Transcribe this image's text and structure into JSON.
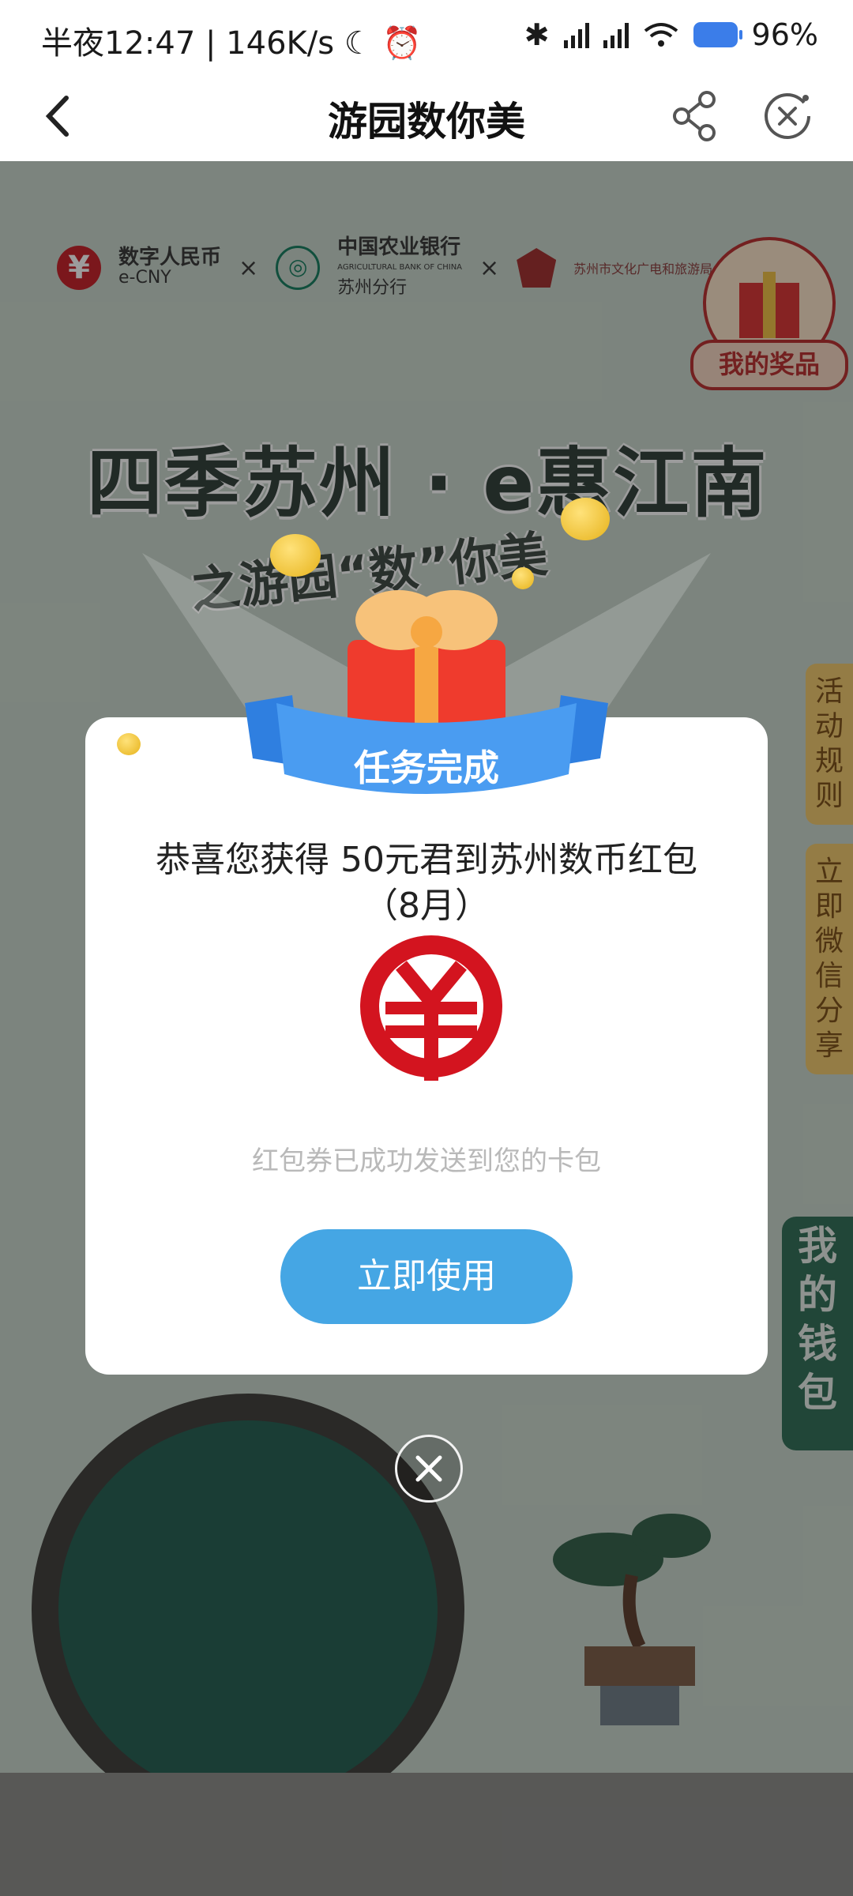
{
  "status_bar": {
    "time_text": "半夜12:47 | 146K/s",
    "battery": "96%"
  },
  "nav": {
    "title": "游园数你美"
  },
  "background": {
    "brand1_cn": "数字人民币",
    "brand1_en": "e-CNY",
    "brand2_cn": "中国农业银行",
    "brand2_en": "AGRICULTURAL BANK OF CHINA",
    "brand2_branch": "苏州分行",
    "brand3_cn": "苏州市文化广电和旅游局",
    "times": "×",
    "prize_button": "我的奖品",
    "headline": "四季苏州 · e惠江南",
    "subheadline": "之游园“数”你美",
    "side_rules": "活动规则",
    "side_share": "立即微信分享",
    "wallet_button": "我的钱包"
  },
  "dialog": {
    "banner_label": "任务完成",
    "message_line1": "恭喜您获得 50元君到苏州数币红包",
    "message_line2": "（8月）",
    "ecny_symbol": "¥",
    "note": "红包券已成功发送到您的卡包",
    "use_button": "立即使用"
  },
  "colors": {
    "accent_blue": "#45a6e4",
    "ecny_red": "#d3141f",
    "wallet_green": "#2c6b53"
  }
}
